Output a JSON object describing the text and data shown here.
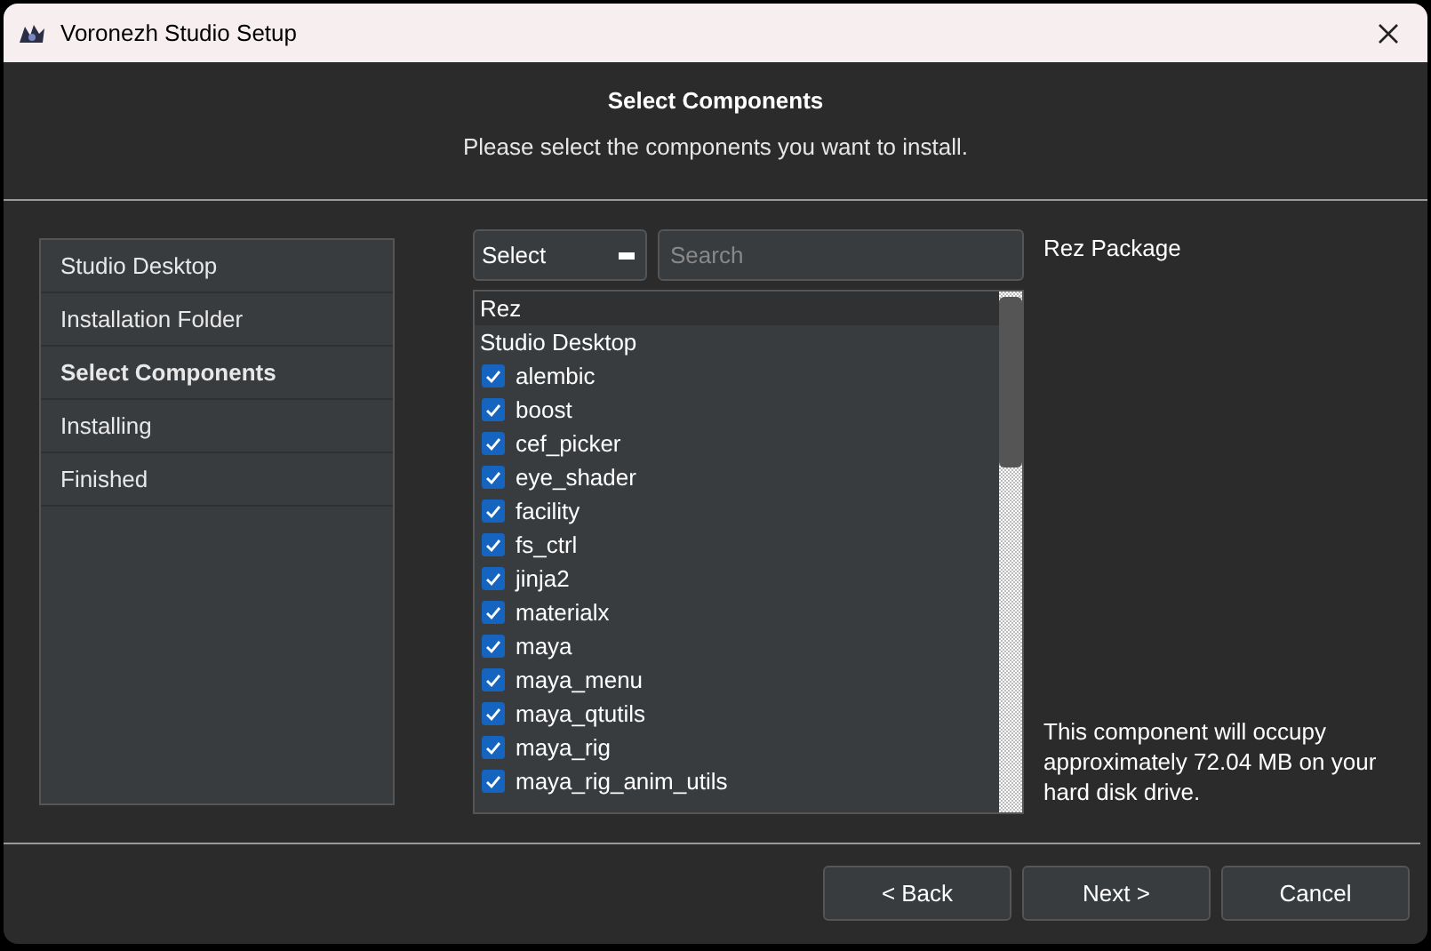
{
  "window": {
    "title": "Voronezh Studio Setup"
  },
  "header": {
    "title": "Select Components",
    "subtitle": "Please select the components you want to install."
  },
  "steps": [
    {
      "label": "Studio Desktop",
      "selected": false
    },
    {
      "label": "Installation Folder",
      "selected": false
    },
    {
      "label": "Select Components",
      "selected": true
    },
    {
      "label": "Installing",
      "selected": false
    },
    {
      "label": "Finished",
      "selected": false
    }
  ],
  "select_dropdown": {
    "value": "Select"
  },
  "search": {
    "placeholder": "Search"
  },
  "components": [
    {
      "kind": "group",
      "label": "Rez",
      "selected": true
    },
    {
      "kind": "group",
      "label": "Studio Desktop",
      "selected": false
    },
    {
      "kind": "package",
      "label": "alembic",
      "checked": true
    },
    {
      "kind": "package",
      "label": "boost",
      "checked": true
    },
    {
      "kind": "package",
      "label": "cef_picker",
      "checked": true
    },
    {
      "kind": "package",
      "label": "eye_shader",
      "checked": true
    },
    {
      "kind": "package",
      "label": "facility",
      "checked": true
    },
    {
      "kind": "package",
      "label": "fs_ctrl",
      "checked": true
    },
    {
      "kind": "package",
      "label": "jinja2",
      "checked": true
    },
    {
      "kind": "package",
      "label": "materialx",
      "checked": true
    },
    {
      "kind": "package",
      "label": "maya",
      "checked": true
    },
    {
      "kind": "package",
      "label": "maya_menu",
      "checked": true
    },
    {
      "kind": "package",
      "label": "maya_qtutils",
      "checked": true
    },
    {
      "kind": "package",
      "label": "maya_rig",
      "checked": true
    },
    {
      "kind": "package",
      "label": "maya_rig_anim_utils",
      "checked": true
    }
  ],
  "description": {
    "title": "Rez Package",
    "size_note": "This component will occupy approximately 72.04 MB on your hard disk drive."
  },
  "buttons": [
    "< Back",
    "Next >",
    "Cancel"
  ]
}
